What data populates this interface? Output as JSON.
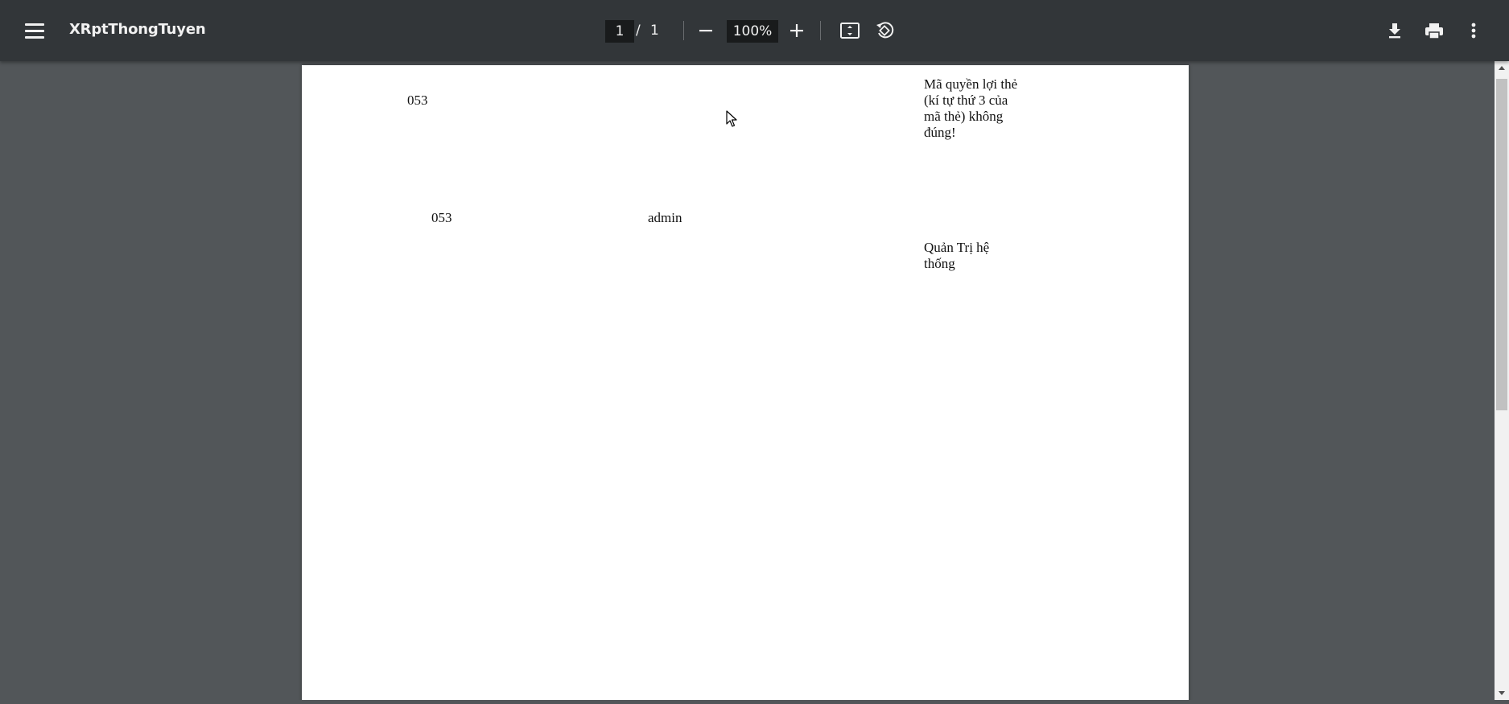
{
  "toolbar": {
    "title": "XRptThongTuyen",
    "page_current": "1",
    "page_separator": "/",
    "page_total": "1",
    "zoom": "100%",
    "icons": {
      "menu": "menu-icon",
      "zoom_out": "minus-icon",
      "zoom_in": "plus-icon",
      "fit": "fit-page-icon",
      "rotate": "rotate-icon",
      "download": "download-icon",
      "print": "print-icon",
      "more": "more-vert-icon"
    }
  },
  "document": {
    "row1_code": "053",
    "row1_message_lines": [
      "Mã quyền lợi thẻ",
      "(kí tự thứ 3 của",
      "mã thẻ) không",
      "đúng!"
    ],
    "row2_code": "053",
    "row2_user": "admin",
    "row2_role_lines": [
      "Quản Trị hệ",
      "thống"
    ]
  },
  "colors": {
    "toolbar_bg": "#323639",
    "viewer_bg": "#525659",
    "page_bg": "#ffffff",
    "scrollbar_track": "#f1f1f1",
    "scrollbar_thumb": "#c1c1c1"
  }
}
